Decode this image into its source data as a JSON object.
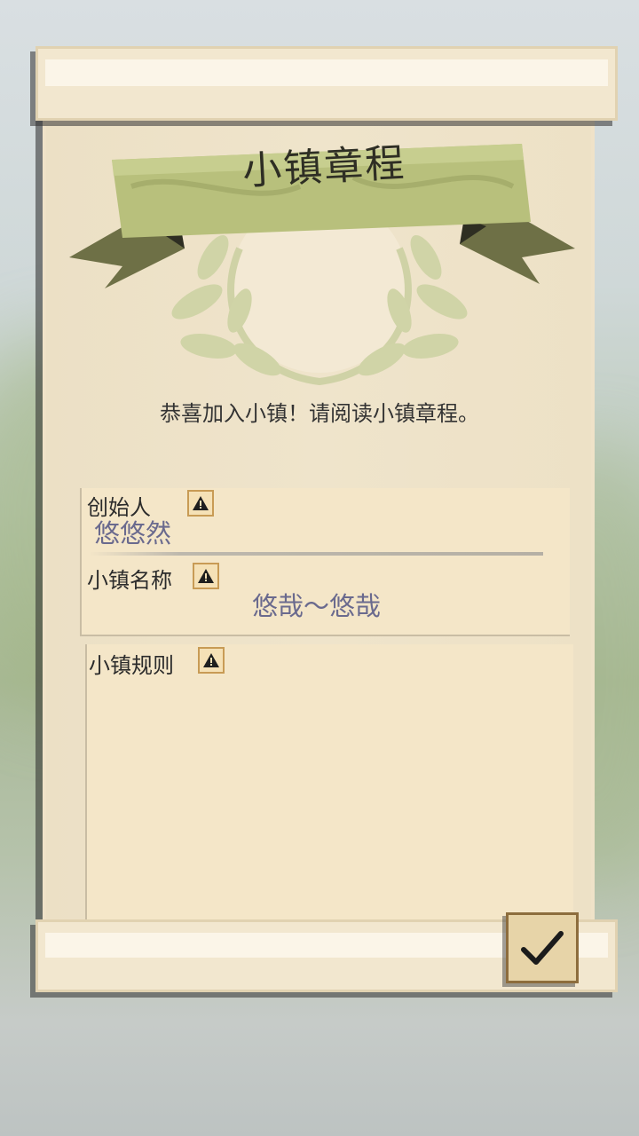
{
  "charter": {
    "title": "小镇章程",
    "welcome_text": "恭喜加入小镇！请阅读小镇章程。",
    "founder": {
      "label": "创始人",
      "value": "悠悠然",
      "icon": "warning-icon"
    },
    "town_name": {
      "label": "小镇名称",
      "value": "悠哉～悠哉",
      "icon": "warning-icon"
    },
    "town_rules": {
      "label": "小镇规则",
      "value": "",
      "icon": "warning-icon"
    },
    "confirm_icon": "checkmark-icon"
  },
  "colors": {
    "banner": "#b7c07c",
    "paper": "#efe2c8",
    "value_text": "#6a6a8e",
    "warning_border": "#c89b55"
  }
}
